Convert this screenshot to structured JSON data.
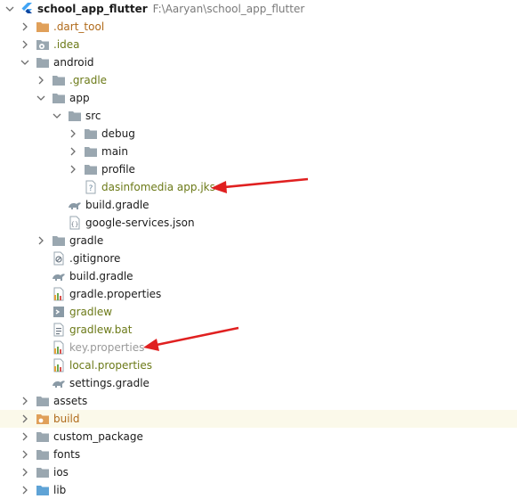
{
  "project": {
    "name": "school_app_flutter",
    "path": "F:\\Aaryan\\school_app_flutter"
  },
  "tree": [
    {
      "label": ".dart_tool",
      "color": "#b06a1a",
      "icon": "folder-excluded-icon"
    },
    {
      "label": ".idea",
      "color": "#6c7a18",
      "icon": "folder-config-icon"
    },
    {
      "label": "android",
      "color": "#1b1b1b",
      "icon": "folder-icon"
    },
    {
      "label": ".gradle",
      "color": "#6c7a18",
      "icon": "folder-icon"
    },
    {
      "label": "app",
      "color": "#1b1b1b",
      "icon": "folder-icon"
    },
    {
      "label": "src",
      "color": "#1b1b1b",
      "icon": "folder-icon"
    },
    {
      "label": "debug",
      "color": "#1b1b1b",
      "icon": "folder-icon"
    },
    {
      "label": "main",
      "color": "#1b1b1b",
      "icon": "folder-icon"
    },
    {
      "label": "profile",
      "color": "#1b1b1b",
      "icon": "folder-icon"
    },
    {
      "label": "dasinfomedia app.jks",
      "color": "#6c7a18",
      "icon": "unknown-file-icon"
    },
    {
      "label": "build.gradle",
      "color": "#1b1b1b",
      "icon": "gradle-icon"
    },
    {
      "label": "google-services.json",
      "color": "#1b1b1b",
      "icon": "json-file-icon"
    },
    {
      "label": "gradle",
      "color": "#1b1b1b",
      "icon": "folder-icon"
    },
    {
      "label": ".gitignore",
      "color": "#1b1b1b",
      "icon": "gitignore-icon"
    },
    {
      "label": "build.gradle",
      "color": "#1b1b1b",
      "icon": "gradle-icon"
    },
    {
      "label": "gradle.properties",
      "color": "#1b1b1b",
      "icon": "properties-file-icon"
    },
    {
      "label": "gradlew",
      "color": "#6c7a18",
      "icon": "script-file-icon"
    },
    {
      "label": "gradlew.bat",
      "color": "#6c7a18",
      "icon": "bat-file-icon"
    },
    {
      "label": "key.properties",
      "color": "#9a9a9a",
      "icon": "properties-file-icon"
    },
    {
      "label": "local.properties",
      "color": "#6c7a18",
      "icon": "properties-file-icon"
    },
    {
      "label": "settings.gradle",
      "color": "#1b1b1b",
      "icon": "gradle-icon"
    },
    {
      "label": "assets",
      "color": "#1b1b1b",
      "icon": "folder-icon"
    },
    {
      "label": "build",
      "color": "#b06a1a",
      "icon": "folder-excluded-icon"
    },
    {
      "label": "custom_package",
      "color": "#1b1b1b",
      "icon": "folder-icon"
    },
    {
      "label": "fonts",
      "color": "#1b1b1b",
      "icon": "folder-icon"
    },
    {
      "label": "ios",
      "color": "#1b1b1b",
      "icon": "folder-icon"
    },
    {
      "label": "lib",
      "color": "#1b1b1b",
      "icon": "folder-source-icon"
    }
  ],
  "annotation_color": "#e02020"
}
